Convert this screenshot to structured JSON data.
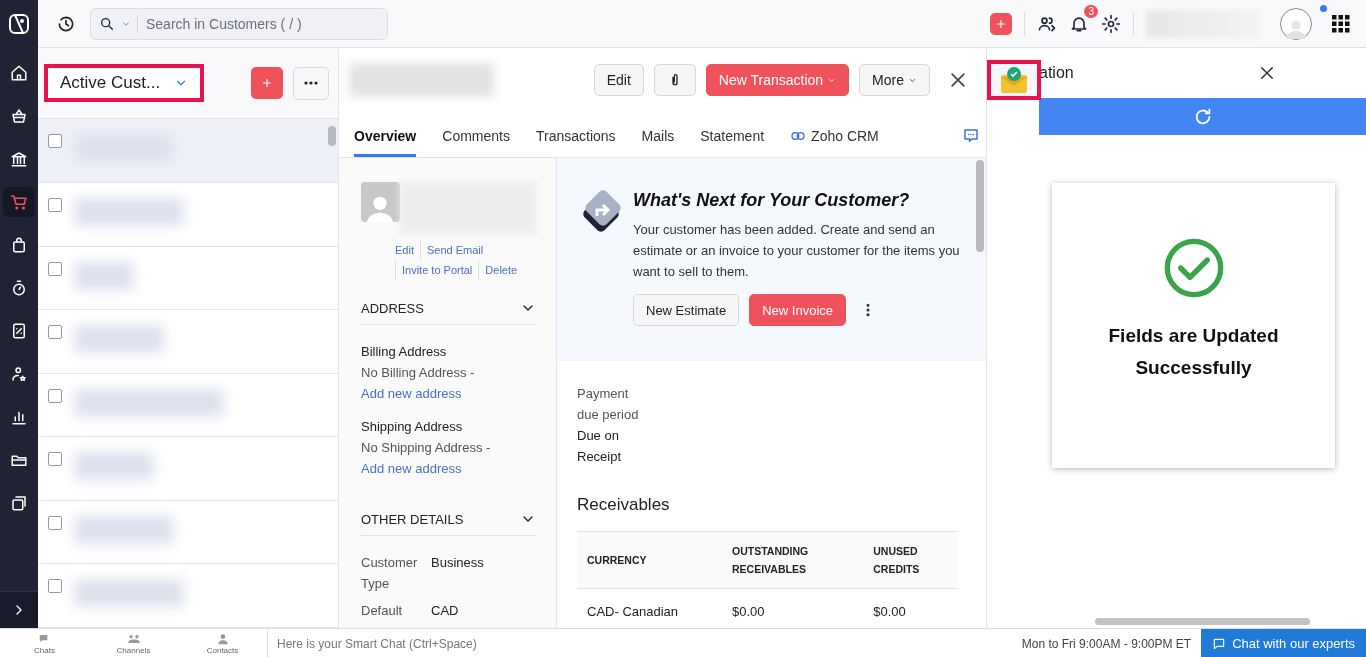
{
  "top_bar": {
    "search_placeholder": "Search in Customers ( / )",
    "notification_count": "3",
    "profile_dot": true
  },
  "nav": [
    {
      "kind": "home",
      "selected": false
    },
    {
      "kind": "basket",
      "selected": false
    },
    {
      "kind": "bank",
      "selected": false
    },
    {
      "kind": "cart",
      "selected": true
    },
    {
      "kind": "bag",
      "selected": false
    },
    {
      "kind": "timer",
      "selected": false
    },
    {
      "kind": "percent",
      "selected": false
    },
    {
      "kind": "user",
      "selected": false
    },
    {
      "kind": "chart",
      "selected": false
    },
    {
      "kind": "folder",
      "selected": false
    },
    {
      "kind": "windows",
      "selected": false
    }
  ],
  "list": {
    "title": "Active Cust...",
    "rows": [
      {
        "checked": false,
        "selected": true
      },
      {
        "checked": false,
        "selected": false
      },
      {
        "checked": false,
        "selected": false
      },
      {
        "checked": false,
        "selected": false
      },
      {
        "checked": false,
        "selected": false
      },
      {
        "checked": false,
        "selected": false
      },
      {
        "checked": false,
        "selected": false
      },
      {
        "checked": false,
        "selected": false
      }
    ]
  },
  "detail": {
    "edit_button": "Edit",
    "new_transaction_button": "New Transaction",
    "more_button": "More",
    "tabs": [
      {
        "label": "Overview",
        "selected": true,
        "kind": "text"
      },
      {
        "label": "Comments",
        "selected": false,
        "kind": "text"
      },
      {
        "label": "Transactions",
        "selected": false,
        "kind": "text"
      },
      {
        "label": "Mails",
        "selected": false,
        "kind": "text"
      },
      {
        "label": "Statement",
        "selected": false,
        "kind": "text"
      },
      {
        "label": "Zoho CRM",
        "selected": false,
        "kind": "link"
      }
    ],
    "contact_links": [
      "Edit",
      "Send Email",
      "Invite to Portal",
      "Delete"
    ],
    "address": {
      "heading": "ADDRESS",
      "groups": [
        {
          "label": "Billing Address",
          "value": "No Billing Address - ",
          "link": "Add new address"
        },
        {
          "label": "Shipping Address",
          "value": "No Shipping Address - ",
          "link": "Add new address"
        }
      ]
    },
    "other_details": {
      "heading": "OTHER DETAILS",
      "fields": [
        {
          "label": "Customer Type",
          "value": "Business"
        },
        {
          "label": "Default",
          "value": "CAD"
        }
      ]
    },
    "next_steps": {
      "title": "What's Next for Your Customer?",
      "text": "Your customer has been added. Create and send an estimate or an invoice to your customer for the items you want to sell to them.",
      "estimate_button": "New Estimate",
      "invoice_button": "New Invoice"
    },
    "payment": {
      "label": "Payment due period",
      "value": "Due on Receipt"
    },
    "receivables": {
      "title": "Receivables",
      "columns": [
        "CURRENCY",
        "OUTSTANDING RECEIVABLES",
        "UNUSED CREDITS"
      ],
      "rows": [
        [
          "CAD- Canadian",
          "$0.00",
          "$0.00"
        ]
      ]
    }
  },
  "side_panel": {
    "title": "ation",
    "message": "Fields are Updated Successfully"
  },
  "bottom_bar": {
    "tabs": [
      {
        "kind": "chats",
        "label": "Chats"
      },
      {
        "kind": "channels",
        "label": "Channels"
      },
      {
        "kind": "contacts",
        "label": "Contacts"
      }
    ],
    "chat_placeholder": "Here is your Smart Chat (Ctrl+Space)",
    "hours": "Mon to Fri 9:00AM - 9:00PM ET",
    "chat_button": "Chat with our experts"
  }
}
